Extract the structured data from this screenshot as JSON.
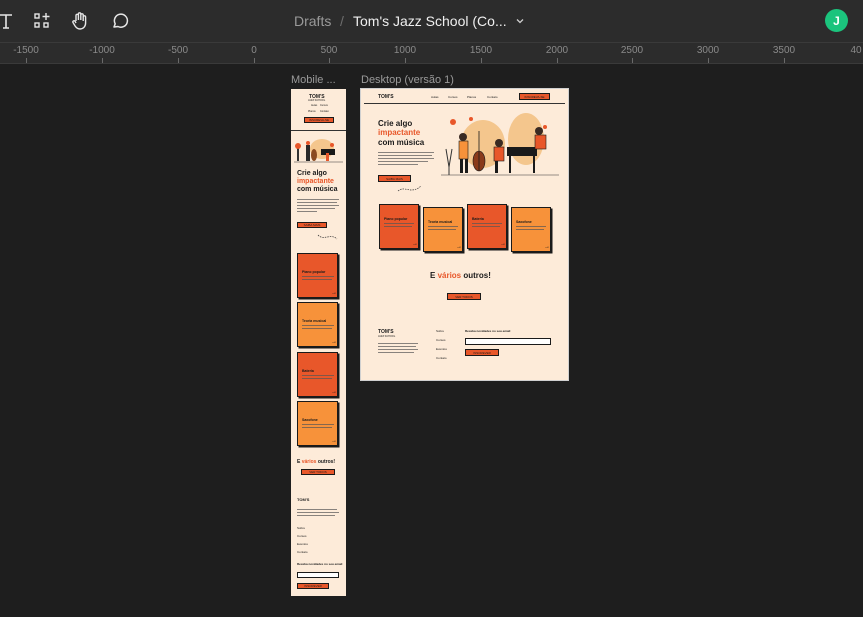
{
  "breadcrumb": {
    "drafts": "Drafts",
    "separator": "/",
    "file_name": "Tom's Jazz School (Co..."
  },
  "user": {
    "initial": "J"
  },
  "ruler": {
    "ticks": [
      "-1500",
      "-1000",
      "-500",
      "0",
      "500",
      "1000",
      "1500",
      "2000",
      "2500",
      "3000",
      "3500",
      "40"
    ]
  },
  "frames": {
    "mobile_label": "Mobile ...",
    "desktop_label": "Desktop (versão 1)"
  },
  "site": {
    "logo": "TOM'S",
    "logo_sub": "JAZZ SCHOOL",
    "nav": [
      "Aulas",
      "Cursos",
      "Planos",
      "Contato"
    ],
    "nav_cta": "INSCREVA-SE",
    "hero_line1": "Crie algo",
    "hero_line2": "impactante",
    "hero_line3": "com música",
    "hero_cta": "SAIBA MAIS",
    "cards": [
      "Piano popular",
      "Teoria musical",
      "Bateria",
      "Saxofone"
    ],
    "more_prefix": "E ",
    "more_highlight": "vários",
    "more_suffix": " outros!",
    "more_cta": "VER TODOS",
    "footer_links": [
      "Sobre",
      "Cursos",
      "Eventos",
      "Contato"
    ],
    "newsletter_label": "Receba novidades no seu email",
    "newsletter_cta": "INSCREVER"
  },
  "colors": {
    "accent": "#e8572a",
    "accent_light": "#f7923a",
    "page_bg": "#fdebd9",
    "canvas": "#1e1e1e",
    "toolbar": "#2c2c2c",
    "avatar": "#1bc47d"
  },
  "icons": [
    "text-tool-icon",
    "component-tool-icon",
    "hand-tool-icon",
    "comment-tool-icon",
    "chevron-down-icon"
  ]
}
